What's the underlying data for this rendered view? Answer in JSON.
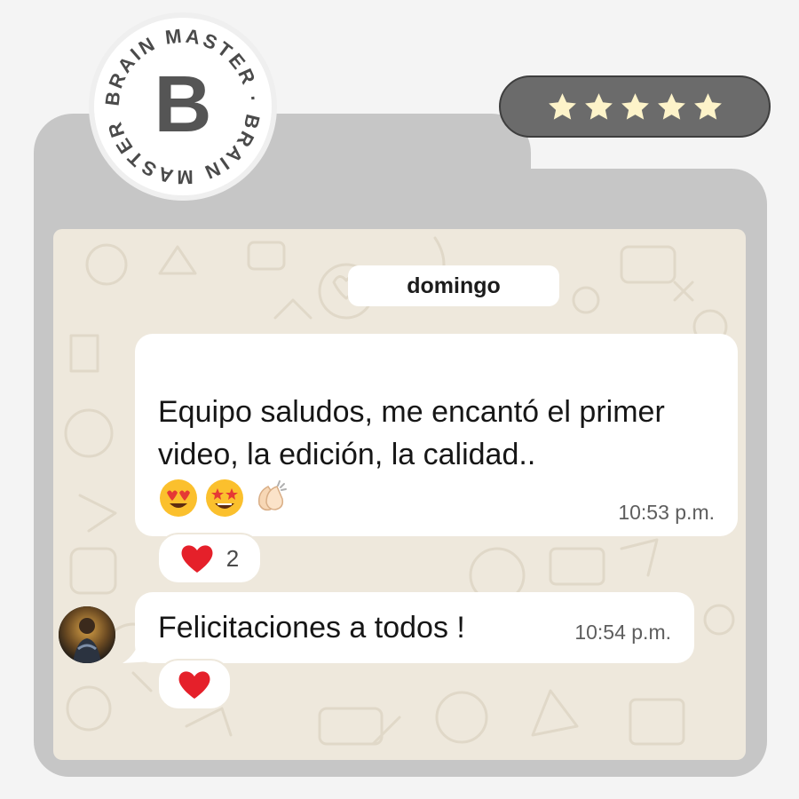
{
  "brand": {
    "logo_letter": "B",
    "ring_text": "BRAIN MASTER · BRAIN MASTER ·"
  },
  "rating": {
    "stars": 5,
    "max": 5,
    "star_color": "#fdf3c9",
    "pill_color": "#6b6b6b"
  },
  "chat": {
    "date_label": "domingo",
    "messages": [
      {
        "text": "Equipo saludos, me encantó el primer video, la edición, la calidad..",
        "emojis": [
          "heart-eyes-emoji",
          "star-struck-emoji",
          "clapping-hands-emoji"
        ],
        "time": "10:53 p.m.",
        "reaction": {
          "icon": "red-heart-icon",
          "count": "2"
        }
      },
      {
        "text": "Felicitaciones a todos !",
        "time": "10:54 p.m.",
        "reaction": {
          "icon": "red-heart-icon",
          "count": ""
        }
      }
    ]
  },
  "colors": {
    "frame": "#c6c6c6",
    "chat_background": "#eee8dc",
    "bubble": "#ffffff",
    "heart": "#e5202a"
  }
}
